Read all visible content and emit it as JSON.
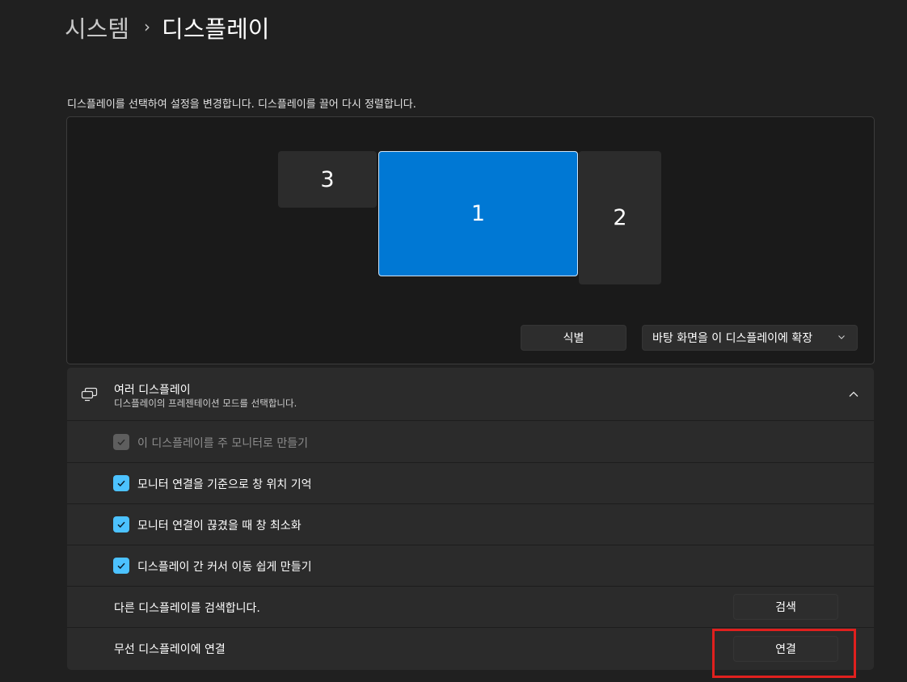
{
  "breadcrumb": {
    "parent": "시스템",
    "separator": "›",
    "current": "디스플레이"
  },
  "arrangement": {
    "description": "디스플레이를 선택하여 설정을 변경합니다. 디스플레이를 끌어 다시 정렬합니다.",
    "monitors": [
      {
        "label": "3",
        "selected": false
      },
      {
        "label": "1",
        "selected": true
      },
      {
        "label": "2",
        "selected": false
      }
    ],
    "identify_label": "식별",
    "mode_dropdown_value": "바탕 화면을 이 디스플레이에 확장"
  },
  "multiple_displays": {
    "icon": "multiple-displays-icon",
    "title": "여러 디스플레이",
    "subtitle": "디스플레이의 프레젠테이션 모드를 선택합니다.",
    "expanded": true,
    "options": [
      {
        "label": "이 디스플레이를 주 모니터로 만들기",
        "checked": true,
        "disabled": true
      },
      {
        "label": "모니터 연결을 기준으로 창 위치 기억",
        "checked": true,
        "disabled": false
      },
      {
        "label": "모니터 연결이 끊겼을 때 창 최소화",
        "checked": true,
        "disabled": false
      },
      {
        "label": "디스플레이 간 커서 이동 쉽게 만들기",
        "checked": true,
        "disabled": false
      }
    ],
    "detect": {
      "label": "다른 디스플레이를 검색합니다.",
      "button": "검색"
    },
    "wireless": {
      "label": "무선 디스플레이에 연결",
      "button": "연결"
    }
  },
  "colors": {
    "accent": "#0078d4",
    "checkbox": "#4cc2ff",
    "highlight": "#e0201e",
    "background": "#202020"
  }
}
